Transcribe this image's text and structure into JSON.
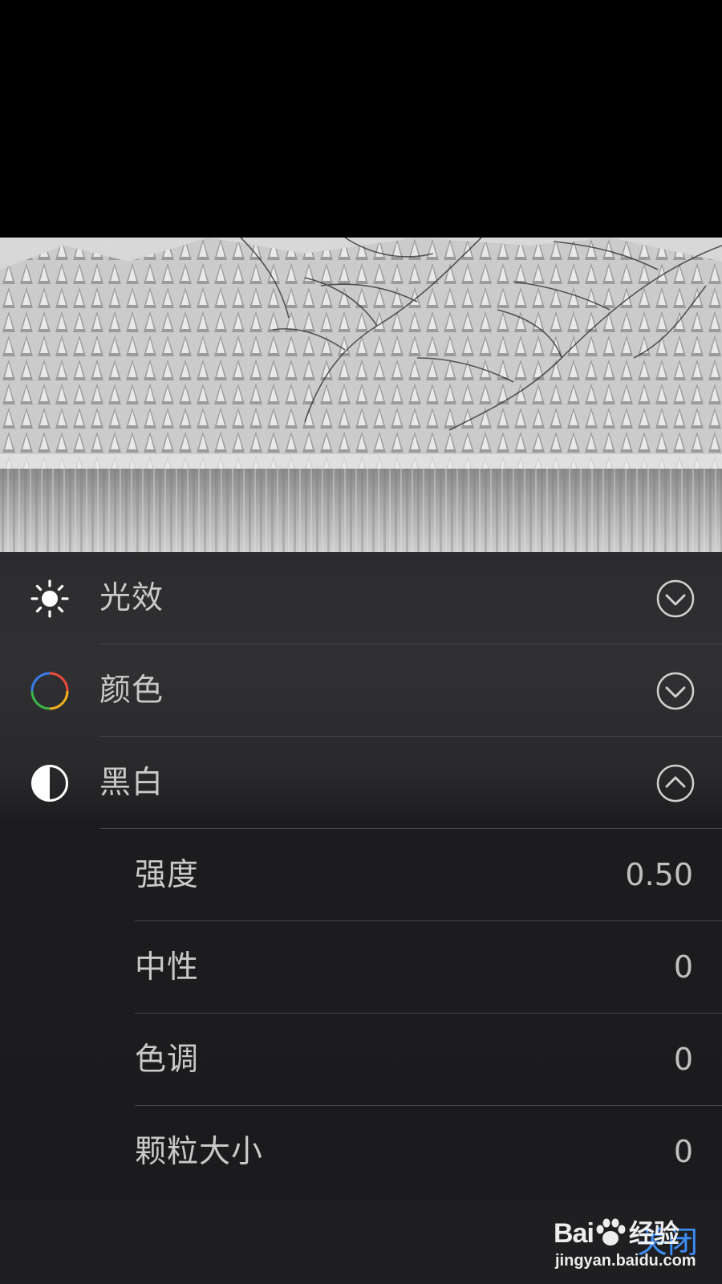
{
  "photo": {
    "description_icon": "landscape-photo"
  },
  "adjustments": {
    "sections": [
      {
        "label": "光效",
        "icon": "sun-icon",
        "state": "collapsed",
        "chevron": "chevron-down-circle-icon"
      },
      {
        "label": "颜色",
        "icon": "color-wheel-icon",
        "state": "collapsed",
        "chevron": "chevron-down-circle-icon"
      },
      {
        "label": "黑白",
        "icon": "half-circle-icon",
        "state": "expanded",
        "chevron": "chevron-up-circle-icon"
      }
    ],
    "bw_items": [
      {
        "label": "强度",
        "value": "0.50"
      },
      {
        "label": "中性",
        "value": "0"
      },
      {
        "label": "色调",
        "value": "0"
      },
      {
        "label": "颗粒大小",
        "value": "0"
      }
    ]
  },
  "bottom_bar": {
    "close_label": "关闭"
  },
  "watermark": {
    "brand": "Bai",
    "brand_suffix": "经验",
    "url": "jingyan.baidu.com"
  },
  "colors": {
    "accent": "#3d8ef7",
    "panel_bg": "#2c2c2e",
    "text": "#c9c9c9",
    "separator": "#48484a"
  }
}
